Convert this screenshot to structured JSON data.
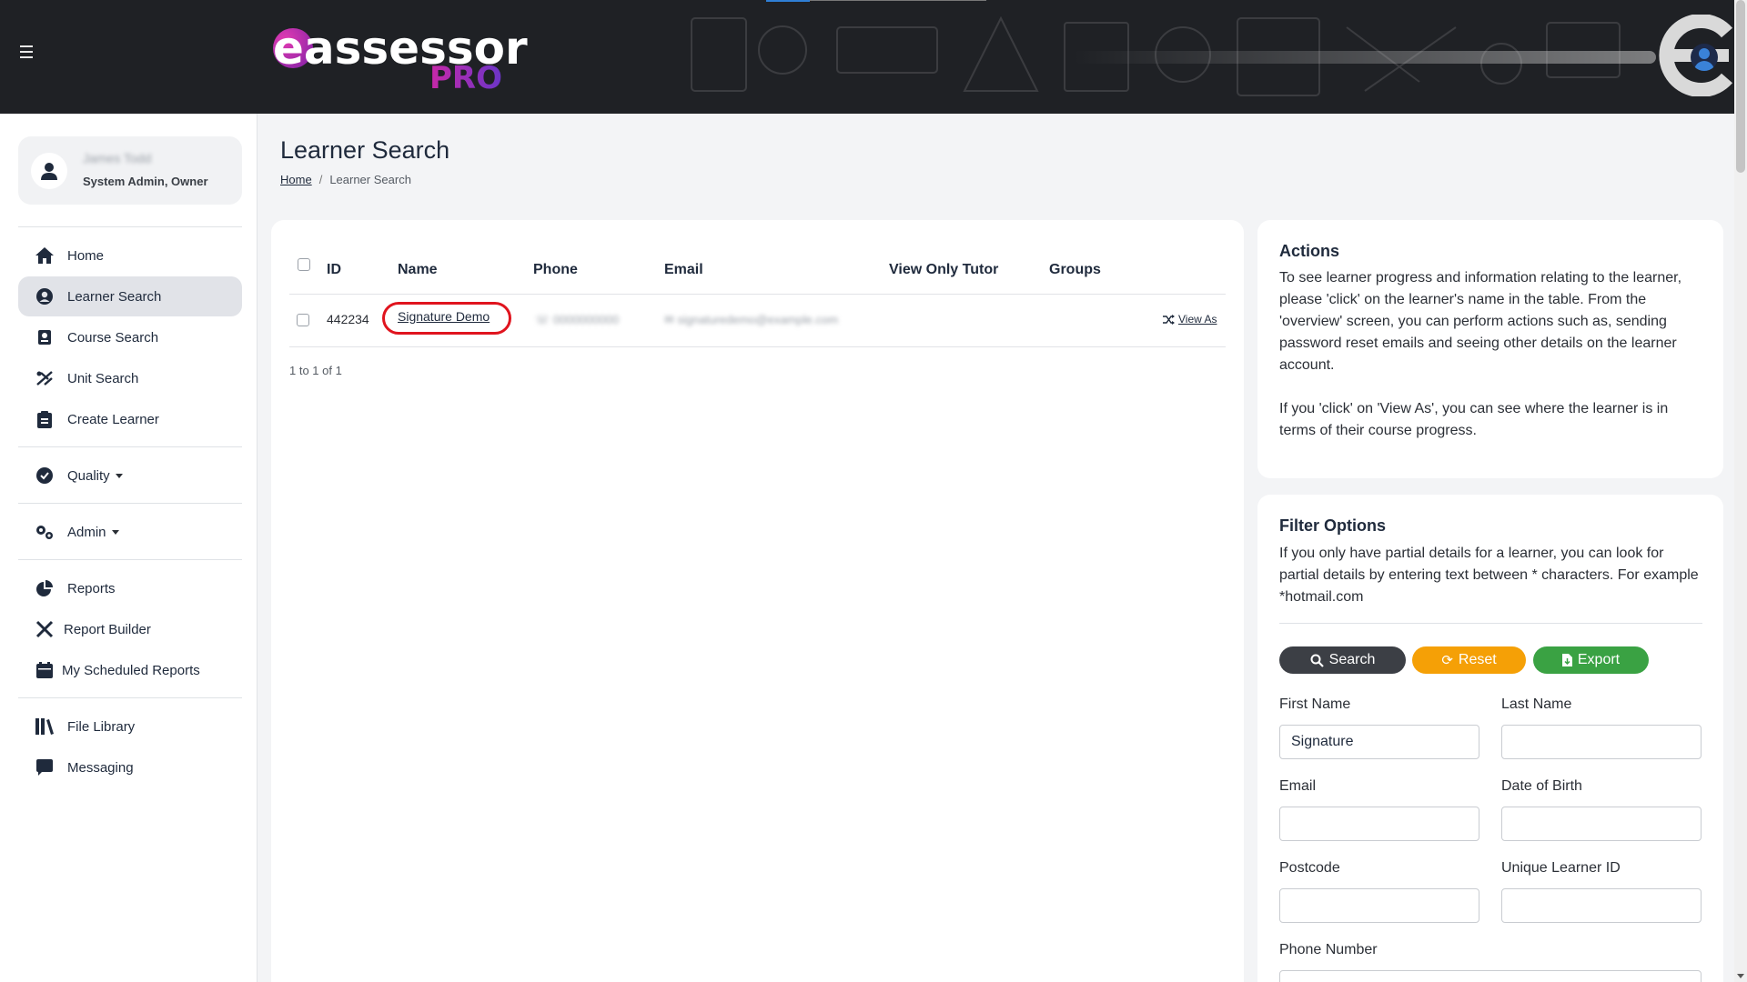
{
  "header": {
    "logo_word": "assessor",
    "logo_e": "e",
    "logo_pro": "PRO"
  },
  "profile": {
    "name": "James Todd",
    "role": "System Admin, Owner"
  },
  "sidebar": {
    "items": [
      {
        "label": "Home",
        "icon": "home-icon"
      },
      {
        "label": "Learner Search",
        "icon": "user-circle-icon"
      },
      {
        "label": "Course Search",
        "icon": "course-icon"
      },
      {
        "label": "Unit Search",
        "icon": "unit-icon"
      },
      {
        "label": "Create Learner",
        "icon": "clipboard-icon"
      },
      {
        "label": "Quality",
        "icon": "check-circle-icon"
      },
      {
        "label": "Admin",
        "icon": "gears-icon"
      },
      {
        "label": "Reports",
        "icon": "pie-chart-icon"
      },
      {
        "label": "Report Builder",
        "icon": "tools-icon"
      },
      {
        "label": "My Scheduled Reports",
        "icon": "calendar-icon"
      },
      {
        "label": "File Library",
        "icon": "books-icon"
      },
      {
        "label": "Messaging",
        "icon": "message-icon"
      }
    ]
  },
  "page": {
    "title": "Learner Search",
    "breadcrumb_home": "Home",
    "breadcrumb_sep": "/",
    "breadcrumb_current": "Learner Search"
  },
  "table": {
    "headers": [
      "ID",
      "Name",
      "Phone",
      "Email",
      "View Only Tutor",
      "Groups"
    ],
    "rows": [
      {
        "id": "442234",
        "name": "Signature Demo",
        "phone": "0000000000",
        "email": "signaturedemo@example.com",
        "view_as": "View As"
      }
    ],
    "pager": "1 to 1 of 1"
  },
  "actions": {
    "title": "Actions",
    "text1": "To see learner progress and information relating to the learner, please 'click' on the learner's name in the table. From the 'overview' screen, you can perform actions such as, sending password reset emails and seeing other details on the learner account.",
    "text2": "If you 'click' on 'View As', you can see where the learner is in terms of their course progress."
  },
  "filter": {
    "title": "Filter Options",
    "text": "If you only have partial details for a learner, you can look for partial details by entering text between * characters. For example *hotmail.com",
    "search_label": "Search",
    "reset_label": "Reset",
    "export_label": "Export",
    "fields": {
      "first_name": {
        "label": "First Name",
        "value": "Signature"
      },
      "last_name": {
        "label": "Last Name",
        "value": ""
      },
      "email": {
        "label": "Email",
        "value": ""
      },
      "dob": {
        "label": "Date of Birth",
        "value": ""
      },
      "postcode": {
        "label": "Postcode",
        "value": ""
      },
      "uln": {
        "label": "Unique Learner ID",
        "value": ""
      },
      "phone": {
        "label": "Phone Number",
        "value": ""
      }
    }
  },
  "colors": {
    "search_btn": "#3c3f45",
    "reset_btn": "#f5a006",
    "export_btn": "#3aa243",
    "highlight_ring": "#e0141e"
  }
}
